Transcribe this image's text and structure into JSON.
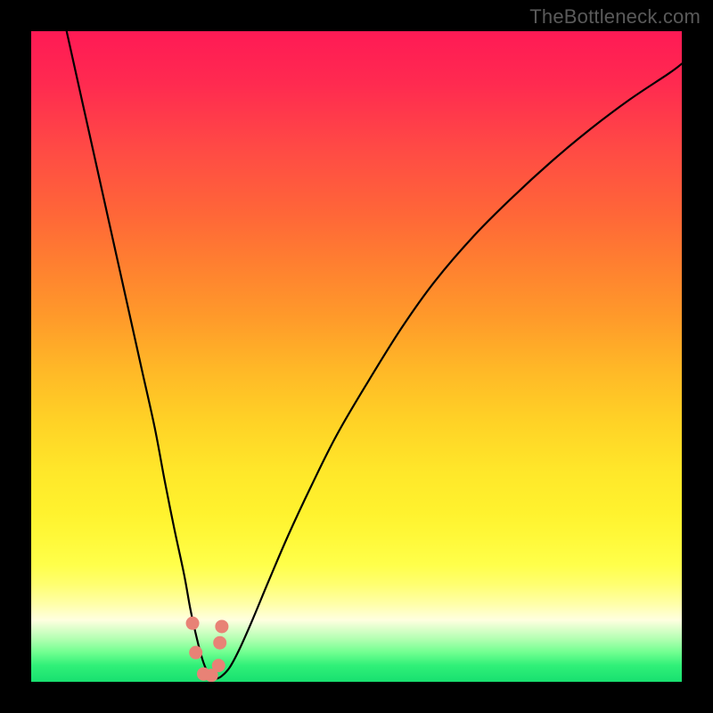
{
  "watermark": "TheBottleneck.com",
  "colors": {
    "frame": "#000000",
    "curve_stroke": "#000000",
    "marker_fill": "#e88276",
    "marker_stroke": "#c96a5f"
  },
  "chart_data": {
    "type": "line",
    "title": "",
    "xlabel": "",
    "ylabel": "",
    "xlim": [
      0,
      100
    ],
    "ylim": [
      0,
      100
    ],
    "grid": false,
    "legend": false,
    "series": [
      {
        "name": "bottleneck-curve",
        "x": [
          5,
          7,
          9,
          11,
          13,
          15,
          17,
          19,
          20.5,
          22,
          23.5,
          24.5,
          25.5,
          26.3,
          27,
          27.7,
          28.5,
          29.3,
          30.5,
          32,
          34,
          36.5,
          39.5,
          43,
          47,
          52,
          57,
          62,
          68,
          74,
          80,
          86,
          92,
          98,
          100
        ],
        "y": [
          102,
          93,
          84,
          75,
          66,
          57,
          48,
          39,
          31,
          23.5,
          16.5,
          11,
          6.5,
          3.5,
          1.7,
          0.7,
          0.5,
          0.9,
          2.2,
          5,
          9.5,
          15.5,
          22.5,
          30,
          38,
          46.5,
          54.5,
          61.5,
          68.5,
          74.5,
          80,
          85,
          89.5,
          93.5,
          95
        ]
      }
    ],
    "markers": {
      "name": "highlight-points",
      "x": [
        24.8,
        25.3,
        26.5,
        27.7,
        28.8,
        29.0,
        29.3
      ],
      "y": [
        9.0,
        4.5,
        1.2,
        1.0,
        2.5,
        6.0,
        8.5
      ]
    }
  }
}
